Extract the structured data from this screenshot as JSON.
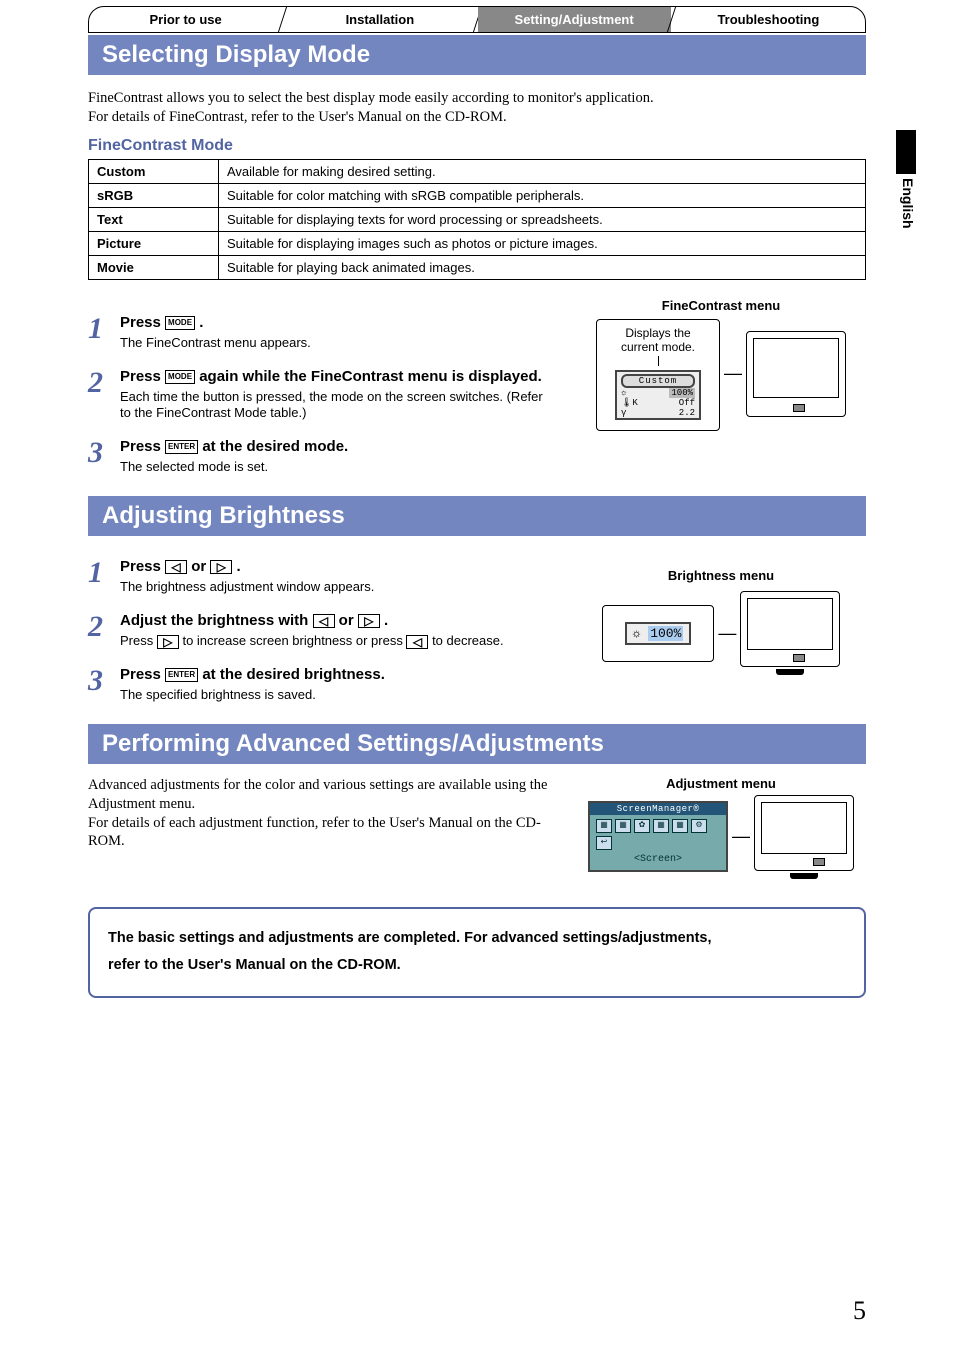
{
  "tabs": {
    "t1": "Prior to use",
    "t2": "Installation",
    "t3": "Setting/Adjustment",
    "t4": "Troubleshooting"
  },
  "sideLang": "English",
  "sec1": {
    "title": "Selecting Display Mode",
    "intro1": "FineContrast allows you to select the best display mode easily according to monitor's application.",
    "intro2": "For details of FineContrast, refer to the User's Manual on the CD-ROM.",
    "subhead": "FineContrast Mode",
    "rows": [
      {
        "k": "Custom",
        "v": "Available for making desired setting."
      },
      {
        "k": "sRGB",
        "v": "Suitable for color matching with sRGB compatible peripherals."
      },
      {
        "k": "Text",
        "v": "Suitable for displaying texts for word processing or spreadsheets."
      },
      {
        "k": "Picture",
        "v": "Suitable for displaying images such as photos or picture images."
      },
      {
        "k": "Movie",
        "v": "Suitable for playing back animated images."
      }
    ],
    "steps": {
      "s1": {
        "pre": "Press ",
        "btn": "MODE",
        "post": " .",
        "sub": "The FineContrast menu appears."
      },
      "s2": {
        "pre": "Press ",
        "btn": "MODE",
        "mid": " again while the FineContrast menu is displayed.",
        "sub": "Each time the button is pressed, the mode on the screen switches. (Refer to the FineContrast Mode table.)"
      },
      "s3": {
        "pre": "Press ",
        "btn": "ENTER",
        "post": " at the desired mode.",
        "sub": "The selected mode is set."
      }
    },
    "diagram": {
      "title": "FineContrast menu",
      "caption1": "Displays the",
      "caption2": "current mode.",
      "osdMode": "Custom",
      "row1a": "☼",
      "row1b": "100%",
      "row2a": "🌡K",
      "row2b": "Off",
      "row3a": "γ",
      "row3b": "2.2"
    }
  },
  "sec2": {
    "title": "Adjusting Brightness",
    "steps": {
      "s1": {
        "pre": "Press ",
        "b1": "◁",
        "mid": " or ",
        "b2": "▷",
        "post": " .",
        "sub": "The brightness adjustment window appears."
      },
      "s2": {
        "pre": "Adjust the brightness with ",
        "b1": "◁",
        "mid": " or ",
        "b2": "▷",
        "post": " .",
        "sub_pre": "Press ",
        "sub_b1": "▷",
        "sub_mid": " to increase screen brightness or press ",
        "sub_b2": "◁",
        "sub_post": " to decrease."
      },
      "s3": {
        "pre": "Press ",
        "btn": "ENTER",
        "post": " at the desired brightness.",
        "sub": "The specified brightness is saved."
      }
    },
    "diagram": {
      "title": "Brightness menu",
      "icon": "☼",
      "value": "100%"
    }
  },
  "sec3": {
    "title": "Performing Advanced Settings/Adjustments",
    "p1": "Advanced adjustments for the color and various settings are available using the Adjustment menu.",
    "p2": "For details of each adjustment function, refer to the User's Manual on the CD-ROM.",
    "diagram": {
      "title": "Adjustment menu",
      "osdTitle": "ScreenManager®",
      "osdLabel": "<Screen>"
    }
  },
  "callout": {
    "l1": "The basic settings and adjustments are completed. For advanced settings/adjustments,",
    "l2": "refer to the User's Manual on the CD-ROM."
  },
  "pageNumber": "5"
}
